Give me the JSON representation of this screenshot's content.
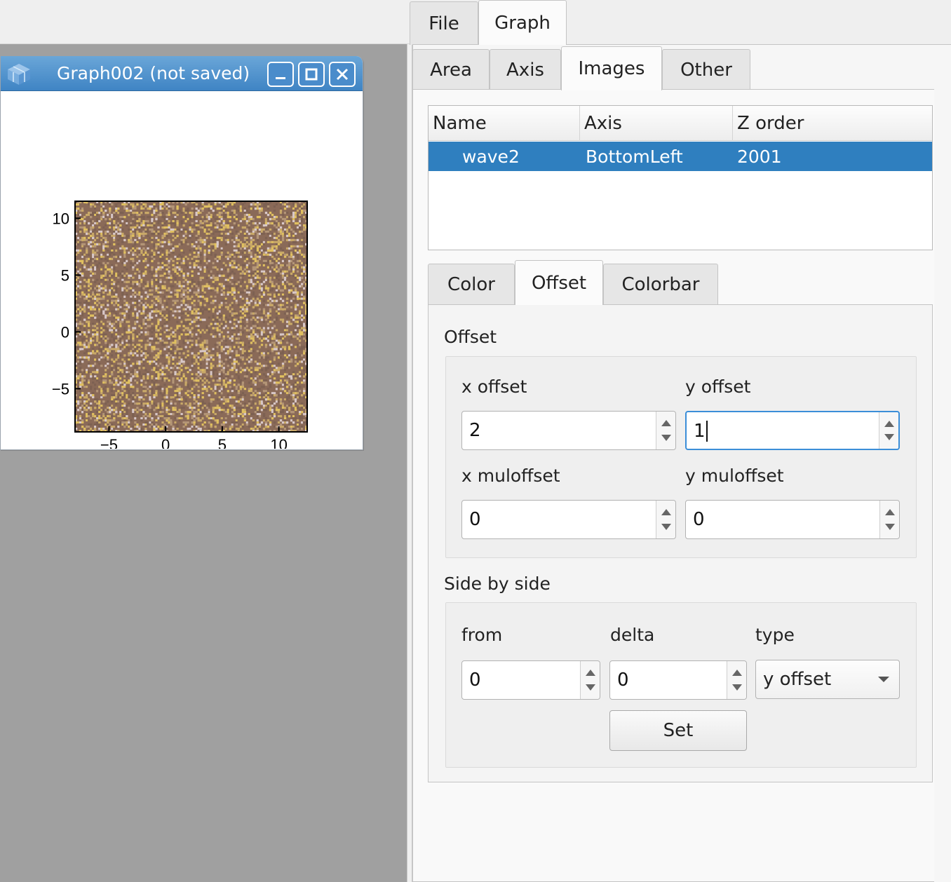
{
  "graph_window": {
    "title": "Graph002 (not saved)",
    "icon": "app-cube-icon",
    "buttons": [
      "minimize-icon",
      "maximize-icon",
      "close-icon"
    ]
  },
  "chart_data": {
    "type": "heatmap",
    "xlim": [
      -8,
      12.5
    ],
    "ylim": [
      -8.8,
      11.5
    ],
    "xticks": [
      -5,
      0,
      5,
      10
    ],
    "yticks": [
      -5,
      0,
      5,
      10
    ],
    "x_tick_labels": [
      "−5",
      "0",
      "5",
      "10"
    ],
    "y_tick_labels": [
      "−5",
      "0",
      "5",
      "10"
    ],
    "palette": [
      "#8a6a58",
      "#7d6152",
      "#c9a968",
      "#e0c060",
      "#d8c8c8",
      "#b39577"
    ],
    "grid": false
  },
  "tabs": {
    "main": [
      {
        "label": "File",
        "active": false
      },
      {
        "label": "Graph",
        "active": true
      }
    ],
    "graph": [
      {
        "label": "Area",
        "active": false
      },
      {
        "label": "Axis",
        "active": false
      },
      {
        "label": "Images",
        "active": true
      },
      {
        "label": "Other",
        "active": false
      }
    ],
    "image": [
      {
        "label": "Color",
        "active": false
      },
      {
        "label": "Offset",
        "active": true
      },
      {
        "label": "Colorbar",
        "active": false
      }
    ]
  },
  "images_table": {
    "headers": [
      "Name",
      "Axis",
      "Z order"
    ],
    "rows": [
      {
        "name": "wave2",
        "axis": "BottomLeft",
        "zorder": "2001",
        "selected": true
      }
    ],
    "selection_color": "#2f7fbf"
  },
  "offset": {
    "section_label": "Offset",
    "x_offset_label": "x offset",
    "x_offset": "2",
    "y_offset_label": "y offset",
    "y_offset": "1",
    "x_muloffset_label": "x muloffset",
    "x_muloffset": "0",
    "y_muloffset_label": "y muloffset",
    "y_muloffset": "0"
  },
  "side_by_side": {
    "section_label": "Side by side",
    "from_label": "from",
    "from": "0",
    "delta_label": "delta",
    "delta": "0",
    "type_label": "type",
    "type": "y offset",
    "set_label": "Set"
  }
}
